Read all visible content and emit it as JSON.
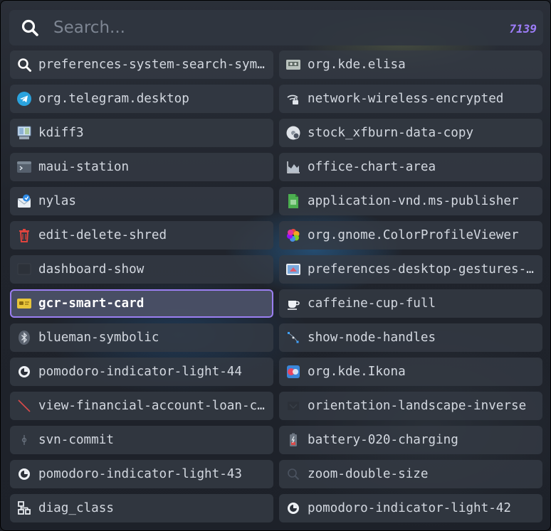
{
  "search": {
    "placeholder": "Search...",
    "value": "",
    "count": "7139"
  },
  "colors": {
    "accent": "#9b7ff2",
    "count": "#9c7cf7"
  },
  "left_items": [
    {
      "label": "preferences-system-search-symbolic",
      "icon": "search-icon"
    },
    {
      "label": "org.telegram.desktop",
      "icon": "telegram-icon"
    },
    {
      "label": "kdiff3",
      "icon": "kdiff3-icon"
    },
    {
      "label": "maui-station",
      "icon": "terminal-icon"
    },
    {
      "label": "nylas",
      "icon": "mail-icon"
    },
    {
      "label": "edit-delete-shred",
      "icon": "trash-icon"
    },
    {
      "label": "dashboard-show",
      "icon": "dashboard-icon"
    },
    {
      "label": "gcr-smart-card",
      "icon": "smart-card-icon",
      "selected": true
    },
    {
      "label": "blueman-symbolic",
      "icon": "bluetooth-icon"
    },
    {
      "label": "pomodoro-indicator-light-44",
      "icon": "pomodoro-icon"
    },
    {
      "label": "view-financial-account-loan-closed",
      "icon": "loan-icon"
    },
    {
      "label": "svn-commit",
      "icon": "commit-icon"
    },
    {
      "label": "pomodoro-indicator-light-43",
      "icon": "pomodoro-icon"
    },
    {
      "label": "diag_class",
      "icon": "class-diagram-icon"
    }
  ],
  "right_items": [
    {
      "label": "org.kde.elisa",
      "icon": "cassette-icon"
    },
    {
      "label": "network-wireless-encrypted",
      "icon": "wifi-lock-icon"
    },
    {
      "label": "stock_xfburn-data-copy",
      "icon": "disc-icon"
    },
    {
      "label": "office-chart-area",
      "icon": "area-chart-icon"
    },
    {
      "label": "application-vnd.ms-publisher",
      "icon": "document-icon"
    },
    {
      "label": "org.gnome.ColorProfileViewer",
      "icon": "color-wheel-icon"
    },
    {
      "label": "preferences-desktop-gestures-touch",
      "icon": "gestures-icon"
    },
    {
      "label": "caffeine-cup-full",
      "icon": "coffee-cup-icon"
    },
    {
      "label": "show-node-handles",
      "icon": "node-handles-icon"
    },
    {
      "label": "org.kde.Ikona",
      "icon": "ikona-icon"
    },
    {
      "label": "orientation-landscape-inverse",
      "icon": "landscape-icon"
    },
    {
      "label": "battery-020-charging",
      "icon": "battery-charging-icon"
    },
    {
      "label": "zoom-double-size",
      "icon": "zoom-icon"
    },
    {
      "label": "pomodoro-indicator-light-42",
      "icon": "pomodoro-icon"
    }
  ]
}
